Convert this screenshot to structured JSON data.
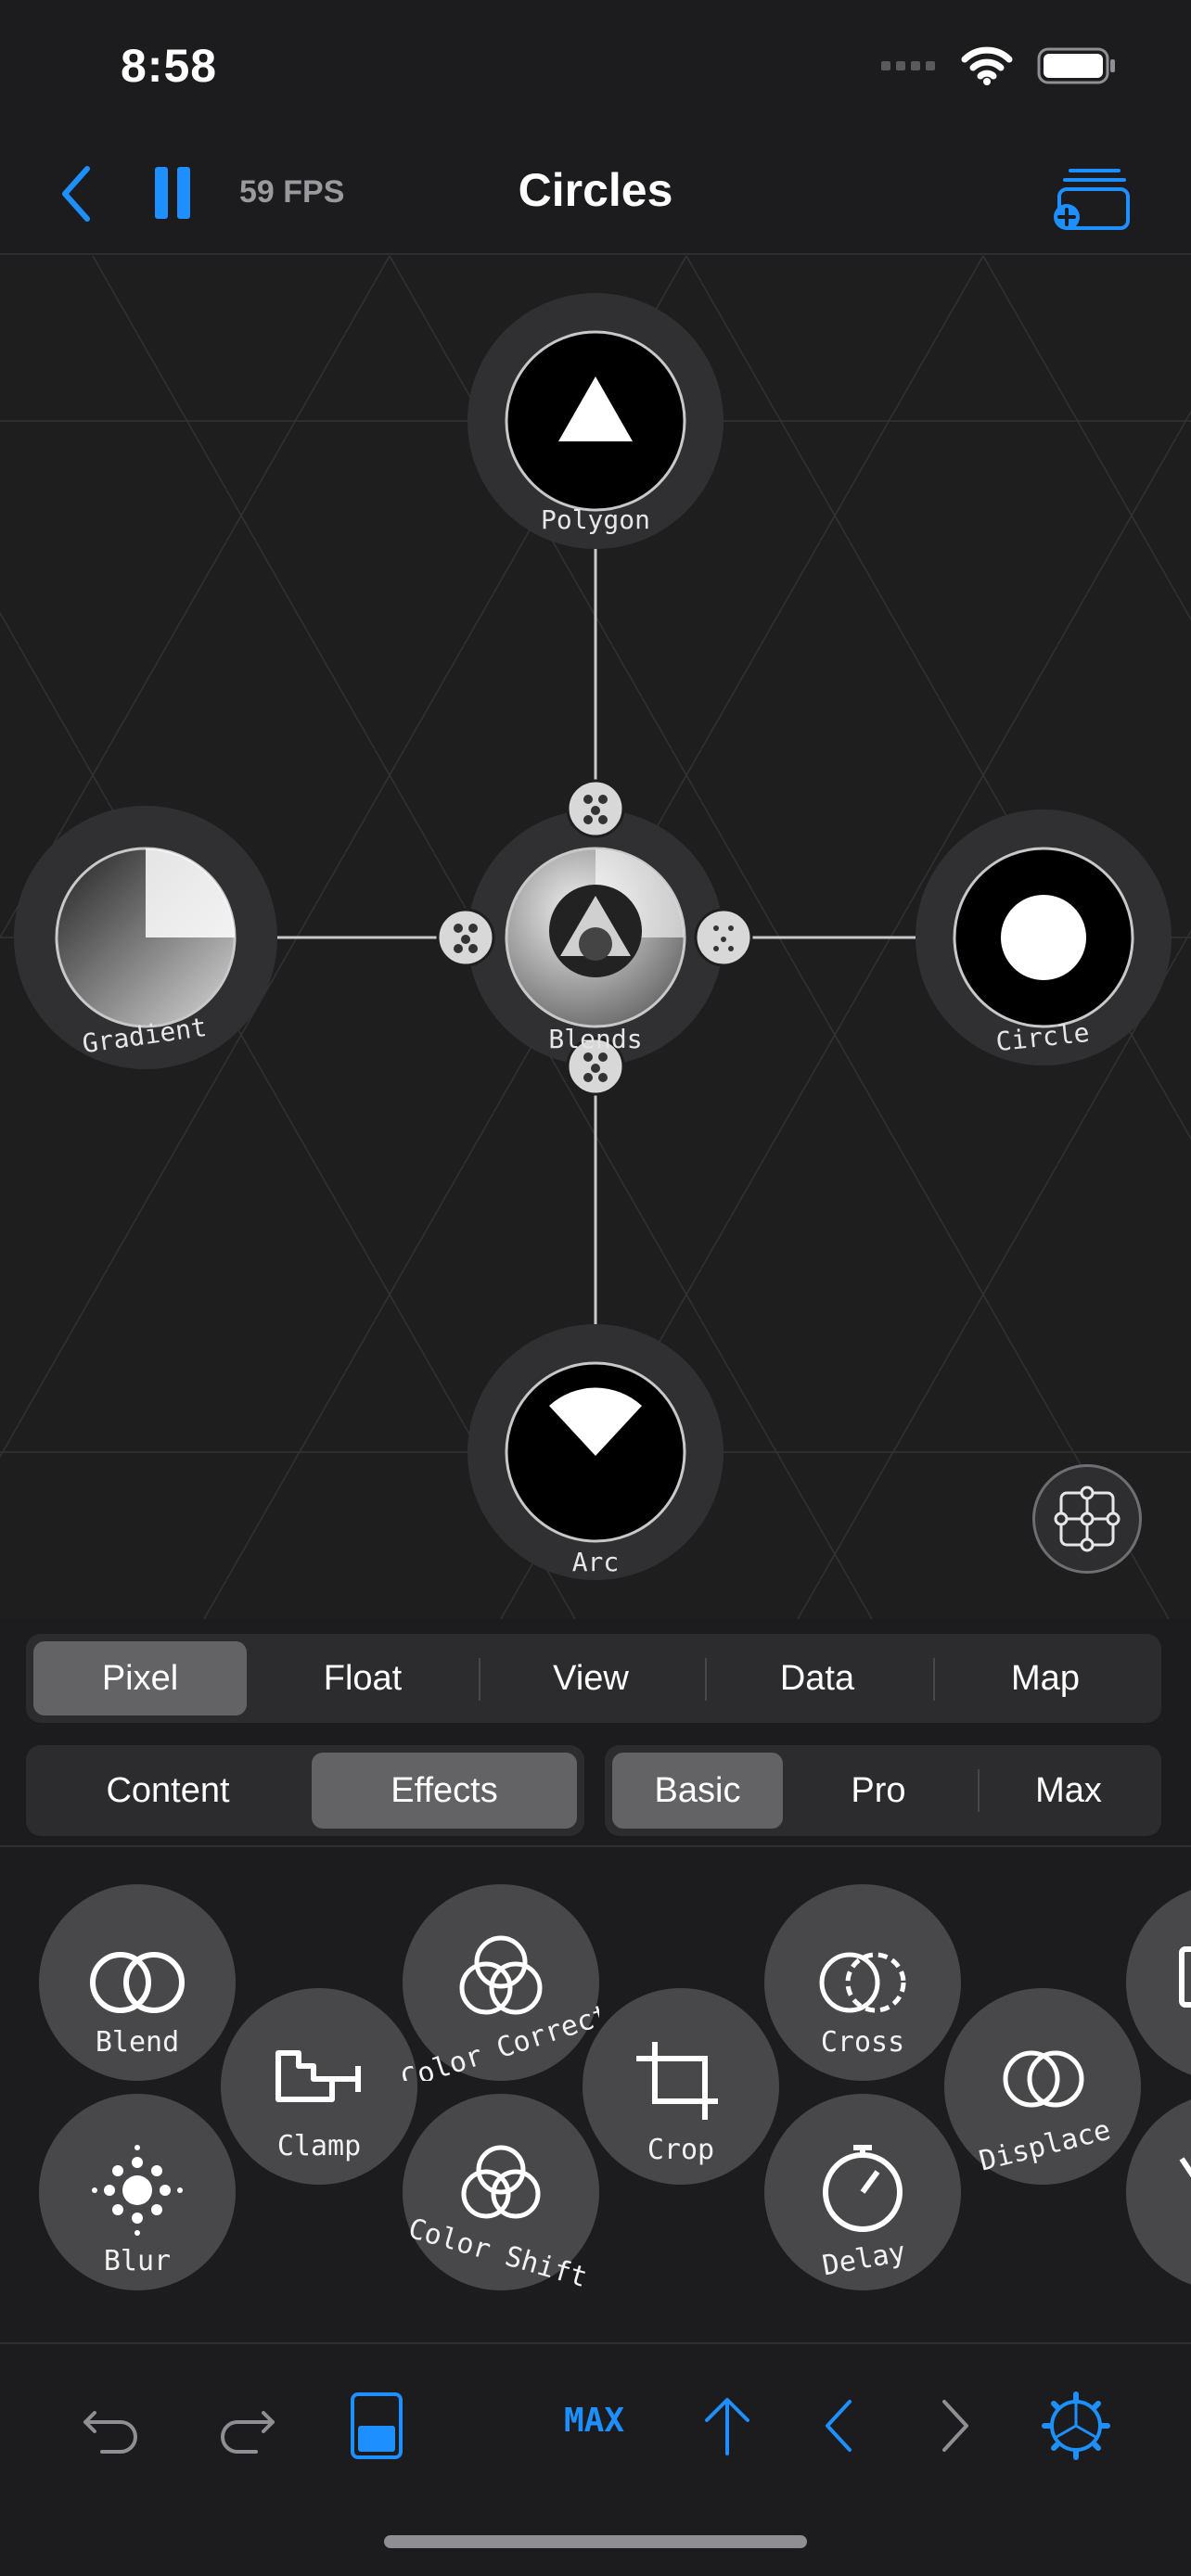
{
  "status_bar": {
    "time": "8:58"
  },
  "nav": {
    "title": "Circles",
    "fps": "59 FPS"
  },
  "nodes": {
    "polygon": "Polygon",
    "gradient": "Gradient",
    "blends": "Blends",
    "circle": "Circle",
    "arc": "Arc"
  },
  "tabs_top": [
    "Pixel",
    "Float",
    "View",
    "Data",
    "Map"
  ],
  "tabs_top_active": "Pixel",
  "tabs_category": [
    "Content",
    "Effects"
  ],
  "tabs_category_active": "Effects",
  "tabs_level": [
    "Basic",
    "Pro",
    "Max"
  ],
  "tabs_level_active": "Basic",
  "effects": [
    "Blend",
    "Blur",
    "Clamp",
    "Color Correct",
    "Color Shift",
    "Crop",
    "Cross",
    "Delay",
    "Displace"
  ],
  "toolbar": {
    "max_label": "MAX"
  },
  "colors": {
    "accent": "#1d8fff",
    "background": "#1c1c1e",
    "canvas": "#1e1e1f",
    "node_ring": "#3a3a3c"
  }
}
